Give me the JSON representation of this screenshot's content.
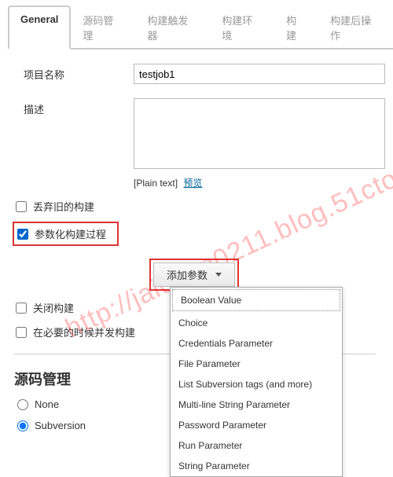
{
  "tabs": {
    "general": "General",
    "scm": "源码管理",
    "triggers": "构建触发器",
    "env": "构建环境",
    "build": "构建",
    "post": "构建后操作"
  },
  "labels": {
    "projectName": "项目名称",
    "description": "描述",
    "plainText": "[Plain text]",
    "preview": "预览"
  },
  "values": {
    "projectName": "testjob1",
    "description": ""
  },
  "checks": {
    "discardOld": "丢弃旧的构建",
    "parameterized": "参数化构建过程",
    "disable": "关闭构建",
    "concurrent": "在必要的时候并发构建"
  },
  "addParam": {
    "button": "添加参数",
    "options": [
      "Boolean Value",
      "Choice",
      "Credentials Parameter",
      "File Parameter",
      "List Subversion tags (and more)",
      "Multi-line String Parameter",
      "Password Parameter",
      "Run Parameter",
      "String Parameter"
    ]
  },
  "scmSection": {
    "title": "源码管理",
    "none": "None",
    "subversion": "Subversion"
  },
  "watermark": "http://jaichen0211.blog.51cto.com/"
}
